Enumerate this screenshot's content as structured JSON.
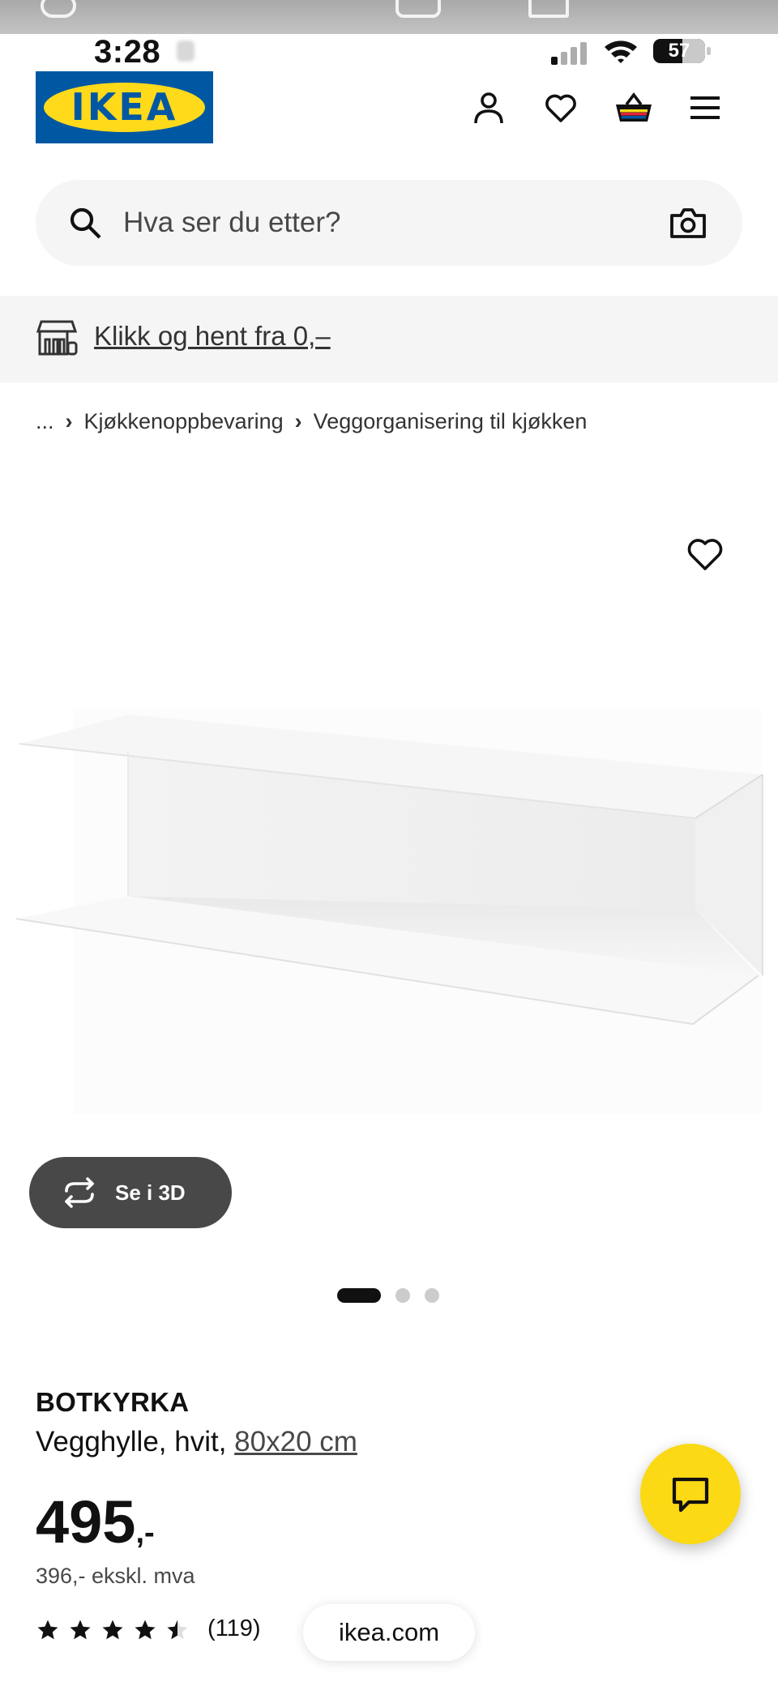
{
  "status_bar": {
    "time": "3:28",
    "battery": "57"
  },
  "header": {
    "logo_text": "IKEA",
    "icons": [
      "account-icon",
      "heart-icon",
      "cart-icon",
      "menu-icon"
    ]
  },
  "search": {
    "placeholder": "Hva ser du etter?",
    "icons": [
      "search-icon",
      "camera-icon"
    ]
  },
  "promo": {
    "text": "Klikk og hent fra 0,–",
    "icon": "store-pickup-icon"
  },
  "breadcrumb": {
    "items": [
      "...",
      "Kjøkkenoppbevaring",
      "Veggorganisering til kjøkken"
    ]
  },
  "gallery": {
    "view_3d_label": "Se i 3D",
    "total_images": 3,
    "active_image": 1
  },
  "product": {
    "name": "BOTKYRKA",
    "description": "Vegghylle, hvit,",
    "size": "80x20 cm",
    "price": "495",
    "price_suffix": ",-",
    "price_ex_vat": "396,- ekskl. mva",
    "rating": 4.5,
    "rating_max": 5,
    "review_count": "(119)"
  },
  "browser": {
    "url": "ikea.com"
  },
  "colors": {
    "ikea_blue": "#0058a3",
    "ikea_yellow": "#ffda1a",
    "chat_yellow": "#fbd914",
    "button_dark": "#484848"
  }
}
